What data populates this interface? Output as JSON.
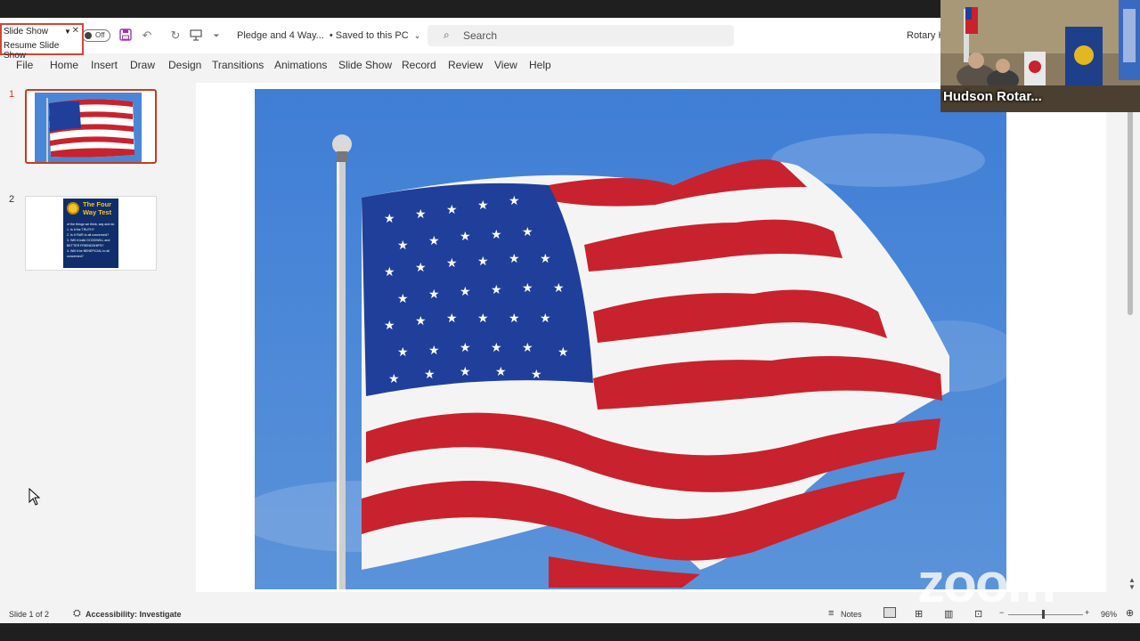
{
  "title_bar": {
    "slideshow_popup": {
      "title": "Slide Show",
      "menu_option": "Resume Slide Show"
    },
    "autosave_toggle": "Off",
    "file_name": "Pledge and 4 Way...",
    "save_status": "• Saved to this PC",
    "search_placeholder": "Search",
    "account_text": "Rotary H"
  },
  "menu": {
    "items": [
      "File",
      "Home",
      "Insert",
      "Draw",
      "Design",
      "Transitions",
      "Animations",
      "Slide Show",
      "Record",
      "Review",
      "View",
      "Help"
    ]
  },
  "slides": [
    {
      "number": "1",
      "selected": true
    },
    {
      "number": "2",
      "title": "The Four Way Test",
      "lines": [
        "of the things we think, say and do",
        "1. Is it the TRUTH?",
        "2. Is it FAIR to all concerned?",
        "3. Will it build GOODWILL and",
        "BETTER FRIENDSHIPS?",
        "4. Will it be BENEFICIAL to all",
        "concerned?"
      ]
    }
  ],
  "status_bar": {
    "slide_counter": "Slide 1 of 2",
    "accessibility": "Accessibility: Investigate",
    "notes": "Notes",
    "zoom_level": "96%"
  },
  "zoom_overlay": {
    "participant_name": "Hudson Rotar...",
    "watermark": "zoom"
  },
  "colors": {
    "selection_red": "#c43e1c",
    "flag_red": "#c8222e",
    "flag_blue": "#1f3f9a",
    "sky_blue": "#3d7bd0"
  }
}
